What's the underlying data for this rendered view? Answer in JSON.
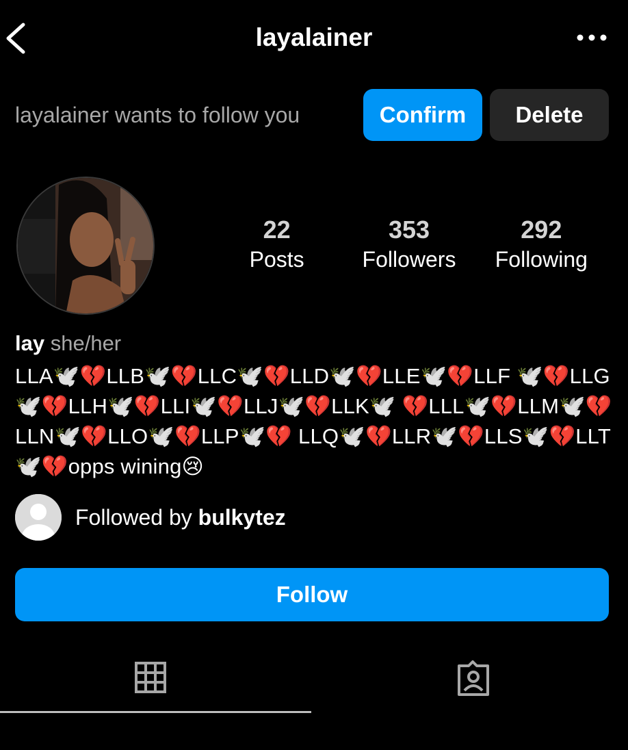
{
  "header": {
    "username": "layalainer",
    "back_icon": "chevron-left-icon",
    "more_icon": "more-horizontal-icon"
  },
  "follow_request": {
    "text": "layalainer wants to follow you",
    "confirm_label": "Confirm",
    "delete_label": "Delete"
  },
  "stats": [
    {
      "value": "22",
      "label": "Posts"
    },
    {
      "value": "353",
      "label": "Followers"
    },
    {
      "value": "292",
      "label": "Following"
    }
  ],
  "bio": {
    "name": "lay",
    "pronouns": "she/her",
    "text": "LLA🕊️💔LLB🕊️💔LLC🕊️💔LLD🕊️💔LLE🕊️💔LLF 🕊️💔LLG🕊️💔LLH🕊️💔LLI🕊️💔LLJ🕊️💔LLK🕊️ 💔LLL🕊️💔LLM🕊️💔LLN🕊️💔LLO🕊️💔LLP🕊️💔 LLQ🕊️💔LLR🕊️💔LLS🕊️💔LLT🕊️💔opps wining😢"
  },
  "mutual": {
    "prefix": "Followed by",
    "name": "bulkytez"
  },
  "actions": {
    "follow_label": "Follow"
  },
  "tabs": [
    {
      "icon": "grid-icon",
      "active": true
    },
    {
      "icon": "tagged-person-icon",
      "active": false
    }
  ],
  "colors": {
    "background": "#000000",
    "accent": "#0095f6",
    "secondary_button": "#262626",
    "muted_text": "#a8a8a8"
  }
}
